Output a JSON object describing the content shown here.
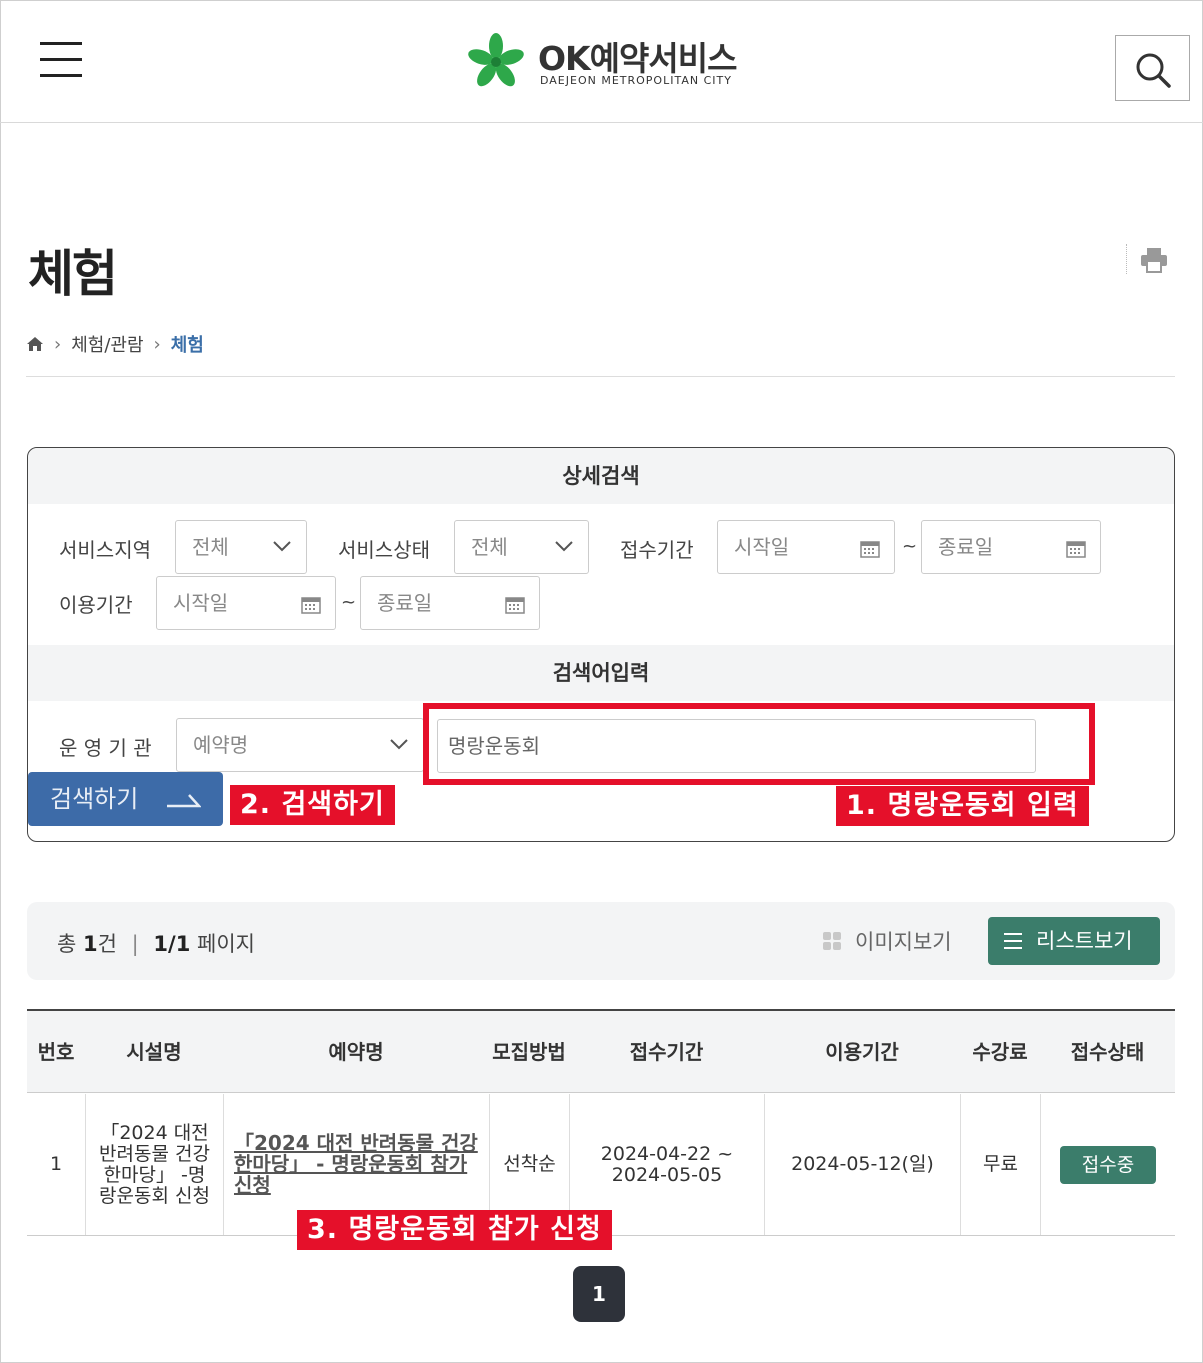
{
  "header": {
    "logo_title": "OK예약서비스",
    "logo_subtitle": "DAEJEON METROPOLITAN CITY",
    "menu_icon": "hamburger-menu-icon",
    "search_icon": "search-icon"
  },
  "page": {
    "title": "체험",
    "print_icon": "print-icon"
  },
  "breadcrumb": {
    "home_icon": "home-icon",
    "items": [
      "체험/관람",
      "체험"
    ]
  },
  "search_panel": {
    "detail_heading": "상세검색",
    "region_label": "서비스지역",
    "region_value": "전체",
    "status_label": "서비스상태",
    "status_value": "전체",
    "reception_label": "접수기간",
    "reception_start": "시작일",
    "reception_end": "종료일",
    "usage_label": "이용기간",
    "usage_start": "시작일",
    "usage_end": "종료일",
    "tilde": "~",
    "keyword_heading": "검색어입력",
    "org_label": "운 영 기 관",
    "keyword_type": "예약명",
    "keyword_value": "명랑운동회",
    "search_button": "검색하기"
  },
  "annotations": {
    "step1": "1. 명랑운동회 입력",
    "step2": "2. 검색하기",
    "step3": "3. 명랑운동회 참가 신청",
    "color": "#e5102a"
  },
  "results": {
    "total_prefix": "총",
    "total_count": "1",
    "total_suffix": "건",
    "divider": "|",
    "page_info": "1/1",
    "page_suffix": "페이지",
    "image_view": "이미지보기",
    "list_view": "리스트보기"
  },
  "table": {
    "headers": [
      "번호",
      "시설명",
      "예약명",
      "모집방법",
      "접수기간",
      "이용기간",
      "수강료",
      "접수상태"
    ],
    "rows": [
      {
        "no": "1",
        "facility": "「2024 대전 반려동물 건강한마당」 -명랑운동회 신청",
        "name": "「2024 대전 반려동물 건강한마당」 - 명랑운동회 참가신청",
        "method": "선착순",
        "reception": "2024-04-22 ~ 2024-05-05",
        "usage": "2024-05-12(일)",
        "fee": "무료",
        "status": "접수중"
      }
    ]
  },
  "pagination": {
    "current": "1"
  },
  "colors": {
    "brand_green": "#3b7d6b",
    "search_blue": "#3d6ba8",
    "breadcrumb_current": "#3b6fa8"
  }
}
